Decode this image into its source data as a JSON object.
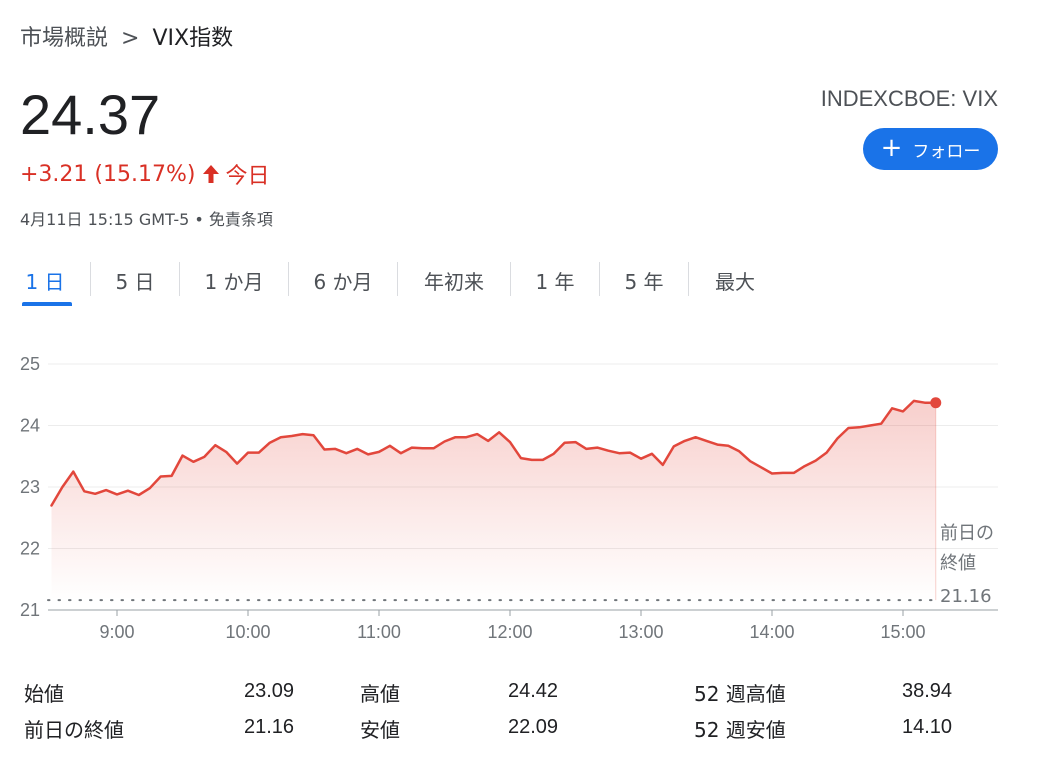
{
  "breadcrumb": {
    "parent": "市場概説",
    "separator": ">",
    "current": "VIX指数"
  },
  "quote": {
    "price": "24.37",
    "change": "+3.21 (15.17%)",
    "period": "今日",
    "timestamp": "4月11日 15:15 GMT-5 • 免責条項",
    "ticker": "INDEXCBOE: VIX",
    "change_color": "#d93025",
    "arrow_icon": "arrow-up-icon"
  },
  "follow_button": {
    "label": "フォロー",
    "icon": "plus-icon",
    "color": "#1a73e8"
  },
  "tabs": [
    {
      "label": "1 日",
      "active": true
    },
    {
      "label": "5 日",
      "active": false
    },
    {
      "label": "1 か月",
      "active": false
    },
    {
      "label": "6 か月",
      "active": false
    },
    {
      "label": "年初来",
      "active": false
    },
    {
      "label": "1 年",
      "active": false
    },
    {
      "label": "5 年",
      "active": false
    },
    {
      "label": "最大",
      "active": false
    }
  ],
  "chart_data": {
    "type": "area",
    "x_ticks": [
      "9:00",
      "10:00",
      "11:00",
      "12:00",
      "13:00",
      "14:00",
      "15:00"
    ],
    "y_ticks": [
      "25",
      "24",
      "23",
      "22",
      "21"
    ],
    "ylim": [
      21,
      25
    ],
    "xlim_minutes": [
      510,
      920
    ],
    "grid": true,
    "line_color": "#e2473c",
    "previous_close": {
      "label_line1": "前日の",
      "label_line2": "終値",
      "value": "21.16"
    },
    "series": [
      {
        "x": [
          510,
          515,
          520,
          525,
          530,
          535,
          540,
          545,
          550,
          555,
          560,
          565,
          570,
          575,
          580,
          585,
          590,
          595,
          600,
          605,
          610,
          615,
          620,
          625,
          630,
          635,
          640,
          645,
          650,
          655,
          660,
          665,
          670,
          675,
          680,
          685,
          690,
          695,
          700,
          705,
          710,
          715,
          720,
          725,
          730,
          735,
          740,
          745,
          750,
          755,
          760,
          765,
          770,
          775,
          780,
          785,
          790,
          795,
          800,
          805,
          810,
          815,
          820,
          825,
          830,
          835,
          840,
          845,
          850,
          855,
          860,
          865,
          870,
          875,
          880,
          885,
          890,
          895,
          900,
          905,
          910,
          915
        ],
        "y": [
          22.7,
          23.0,
          23.25,
          22.93,
          22.89,
          22.95,
          22.88,
          22.94,
          22.87,
          22.98,
          23.17,
          23.18,
          23.51,
          23.41,
          23.49,
          23.68,
          23.57,
          23.38,
          23.56,
          23.56,
          23.72,
          23.81,
          23.83,
          23.86,
          23.84,
          23.61,
          23.62,
          23.55,
          23.62,
          23.53,
          23.57,
          23.67,
          23.55,
          23.64,
          23.63,
          23.63,
          23.74,
          23.81,
          23.81,
          23.86,
          23.75,
          23.89,
          23.73,
          23.47,
          23.44,
          23.44,
          23.54,
          23.72,
          23.73,
          23.62,
          23.64,
          23.59,
          23.55,
          23.56,
          23.46,
          23.54,
          23.36,
          23.66,
          23.75,
          23.81,
          23.75,
          23.69,
          23.67,
          23.58,
          23.42,
          23.32,
          23.22,
          23.23,
          23.23,
          23.34,
          23.43,
          23.56,
          23.79,
          23.96,
          23.97,
          24.0,
          24.03,
          24.28,
          24.23,
          24.4,
          24.37,
          24.37
        ]
      }
    ]
  },
  "stats": [
    {
      "label": "始値",
      "value": "23.09"
    },
    {
      "label": "前日の終値",
      "value": "21.16"
    },
    {
      "label": "高値",
      "value": "24.42"
    },
    {
      "label": "安値",
      "value": "22.09"
    },
    {
      "label": "52 週高値",
      "value": "38.94"
    },
    {
      "label": "52 週安値",
      "value": "14.10"
    }
  ]
}
